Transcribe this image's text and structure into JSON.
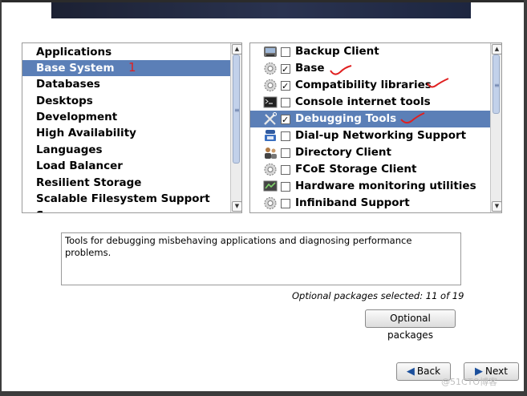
{
  "groups": {
    "items": [
      "Applications",
      "Base System",
      "Databases",
      "Desktops",
      "Development",
      "High Availability",
      "Languages",
      "Load Balancer",
      "Resilient Storage",
      "Scalable Filesystem Support"
    ],
    "selected": "Base System"
  },
  "packages": {
    "items": [
      {
        "label": "Backup Client",
        "checked": false,
        "icon": "backup-drive-icon"
      },
      {
        "label": "Base",
        "checked": true,
        "icon": "gear-icon"
      },
      {
        "label": "Compatibility libraries",
        "checked": true,
        "icon": "gear-icon"
      },
      {
        "label": "Console internet tools",
        "checked": false,
        "icon": "terminal-icon"
      },
      {
        "label": "Debugging Tools",
        "checked": true,
        "icon": "tools-icon"
      },
      {
        "label": "Dial-up Networking Support",
        "checked": false,
        "icon": "phone-icon"
      },
      {
        "label": "Directory Client",
        "checked": false,
        "icon": "users-icon"
      },
      {
        "label": "FCoE Storage Client",
        "checked": false,
        "icon": "gear-icon"
      },
      {
        "label": "Hardware monitoring utilities",
        "checked": false,
        "icon": "monitor-chart-icon"
      },
      {
        "label": "Infiniband Support",
        "checked": false,
        "icon": "gear-icon"
      }
    ],
    "selected": "Debugging Tools"
  },
  "description": "Tools for debugging misbehaving applications and diagnosing performance problems.",
  "optional_count": "Optional packages selected: 11 of 19",
  "buttons": {
    "optional": "Optional packages",
    "back": "Back",
    "next": "Next"
  },
  "annotation_number": "1",
  "watermark": "@51CTO博客"
}
